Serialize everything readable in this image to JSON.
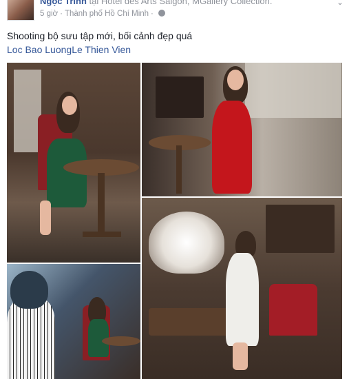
{
  "post": {
    "author": "Ngọc Trinh",
    "at_word": "tại",
    "location_name": "Hotel des Arts Saigon, MGallery Collection.",
    "time": "5 giờ",
    "city": "Thành phố Hồ Chí Minh",
    "message": "Shooting bộ sưu tập mới, bối cảnh đẹp quá",
    "tagged": [
      "Loc Bao Luong",
      "Le Thien Vien"
    ]
  },
  "photos": [
    {
      "icon": "photo-woman-green-dress-chair"
    },
    {
      "icon": "photo-woman-red-dress-bar"
    },
    {
      "icon": "photo-woman-white-dress-chandelier"
    },
    {
      "icon": "photo-photographer-behind-scenes"
    }
  ],
  "colors": {
    "link": "#365899",
    "meta": "#90949c",
    "text": "#1d2129"
  }
}
